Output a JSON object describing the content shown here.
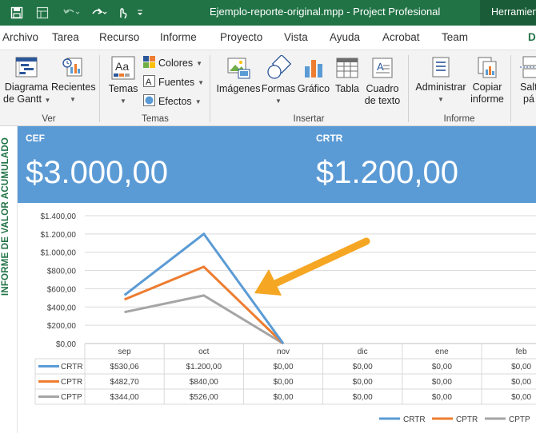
{
  "titlebar": {
    "title": "Ejemplo-reporte-original.mpp  -  Project Profesional",
    "context_tab": "Herramientas"
  },
  "menu": {
    "tabs": [
      "Archivo",
      "Tarea",
      "Recurso",
      "Informe",
      "Proyecto",
      "Vista",
      "Ayuda",
      "Acrobat",
      "Team",
      "D"
    ]
  },
  "ribbon": {
    "ver": {
      "diagrama_line1": "Diagrama",
      "diagrama_line2": "de Gantt",
      "recientes": "Recientes",
      "label": "Ver"
    },
    "temas": {
      "temas": "Temas",
      "colores": "Colores",
      "fuentes": "Fuentes",
      "efectos": "Efectos",
      "label": "Temas"
    },
    "insertar": {
      "imagenes": "Imágenes",
      "formas": "Formas",
      "grafico": "Gráfico",
      "tabla": "Tabla",
      "cuadro_line1": "Cuadro",
      "cuadro_line2": "de texto",
      "label": "Insertar"
    },
    "informe": {
      "administrar": "Administrar",
      "copiar_line1": "Copiar",
      "copiar_line2": "informe",
      "label": "Informe"
    },
    "extra": {
      "salto_line1": "Salt",
      "salto_line2": "pá"
    }
  },
  "report": {
    "side_title": "INFORME DE VALOR ACUMULADO",
    "kpis": [
      {
        "label": "CEF",
        "value": "$3.000,00"
      },
      {
        "label": "CRTR",
        "value": "$1.200,00"
      }
    ]
  },
  "chart_data": {
    "type": "line",
    "categories": [
      "sep",
      "oct",
      "nov",
      "dic",
      "ene",
      "feb"
    ],
    "y_tick_labels": [
      "$1.400,00",
      "$1.200,00",
      "$1.000,00",
      "$800,00",
      "$600,00",
      "$400,00",
      "$200,00",
      "$0,00"
    ],
    "ylim": [
      0,
      1400
    ],
    "grid": true,
    "legend_position": "bottom-right",
    "series": [
      {
        "name": "CRTR",
        "color": "#5b9bd5",
        "values": [
          530.06,
          1200,
          0
        ],
        "labels": [
          "$530,06",
          "$1.200,00",
          "$0,00",
          "$0,00",
          "$0,00",
          "$0,00"
        ]
      },
      {
        "name": "CPTR",
        "color": "#ed7d31",
        "values": [
          482.7,
          840,
          0
        ],
        "labels": [
          "$482,70",
          "$840,00",
          "$0,00",
          "$0,00",
          "$0,00",
          "$0,00"
        ]
      },
      {
        "name": "CPTP",
        "color": "#a5a5a5",
        "values": [
          344,
          526,
          0
        ],
        "labels": [
          "$344,00",
          "$526,00",
          "$0,00",
          "$0,00",
          "$0,00",
          "$0,00"
        ]
      }
    ],
    "annotation_arrow_color": "#f5a623"
  },
  "colors": {
    "brand_green": "#217346",
    "header_blue": "#5b9bd5",
    "ribbon_bg": "#f3f3f3"
  }
}
